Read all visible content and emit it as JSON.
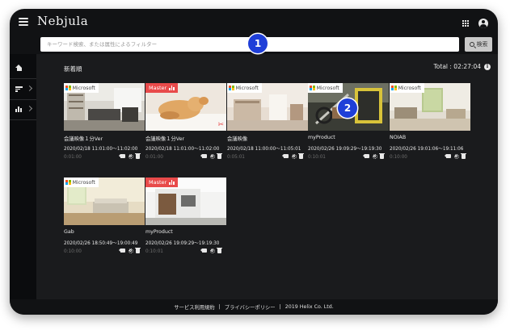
{
  "header": {
    "brand": "Nebjula",
    "menu_icon": "hamburger-menu-icon",
    "apps_icon": "grid-apps-icon",
    "account_icon": "account-circle-icon"
  },
  "search": {
    "placeholder": "キーワード検索、または属性によるフィルター",
    "value": "",
    "button_label": "検索",
    "button_icon": "search-icon"
  },
  "sidebar": {
    "items": [
      {
        "icon": "home-icon"
      },
      {
        "icon": "sort-icon"
      },
      {
        "icon": "bar-chart-icon"
      }
    ]
  },
  "main": {
    "section_title": "新着順",
    "total_label": "Total : 02:27:04",
    "info_icon": "info-icon",
    "info_glyph": "i"
  },
  "badges": {
    "microsoft": "Microsoft",
    "master": "Master"
  },
  "cards": [
    {
      "badge": "microsoft",
      "title": "会議映像１分Ver",
      "date": "2020/02/18 11:01:00～11:02:00",
      "duration": "0:01:00",
      "scene": "room",
      "edit_icon": false
    },
    {
      "badge": "master",
      "title": "会議映像１分Ver",
      "date": "2020/02/18 11:01:00～11:02:00",
      "duration": "0:01:00",
      "scene": "dog",
      "edit_icon": true
    },
    {
      "badge": "microsoft",
      "title": "会議映像",
      "date": "2020/02/18 11:00:00～11:05:01",
      "duration": "0:05:01",
      "scene": "nursery",
      "edit_icon": false
    },
    {
      "badge": "microsoft",
      "title": "myProduct",
      "date": "2020/02/26 19:09:29～19:19:30",
      "duration": "0:10:01",
      "scene": "bike",
      "edit_icon": false
    },
    {
      "badge": "microsoft",
      "title": "NOIAB",
      "date": "2020/02/26 19:01:06～19:11:06",
      "duration": "0:10:00",
      "scene": "living",
      "edit_icon": false
    },
    {
      "badge": "microsoft",
      "title": "Gab",
      "date": "2020/02/26 18:50:49～19:00:49",
      "duration": "0:10:00",
      "scene": "sunroom",
      "edit_icon": false
    },
    {
      "badge": "master",
      "title": "myProduct",
      "date": "2020/02/26 19:09:29～19:19:30",
      "duration": "0:10:01",
      "scene": "house",
      "edit_icon": false
    }
  ],
  "markers": [
    {
      "label": "1"
    },
    {
      "label": "2"
    }
  ],
  "footer": {
    "terms": "サービス利用規約",
    "privacy": "プライバシーポリシー",
    "copyright": "2019 Helix Co. Ltd.",
    "separator": "|"
  },
  "colors": {
    "master_red": "#e84a4a",
    "marker_blue": "#1f3fd8",
    "background_dark": "#1a1b1d"
  }
}
